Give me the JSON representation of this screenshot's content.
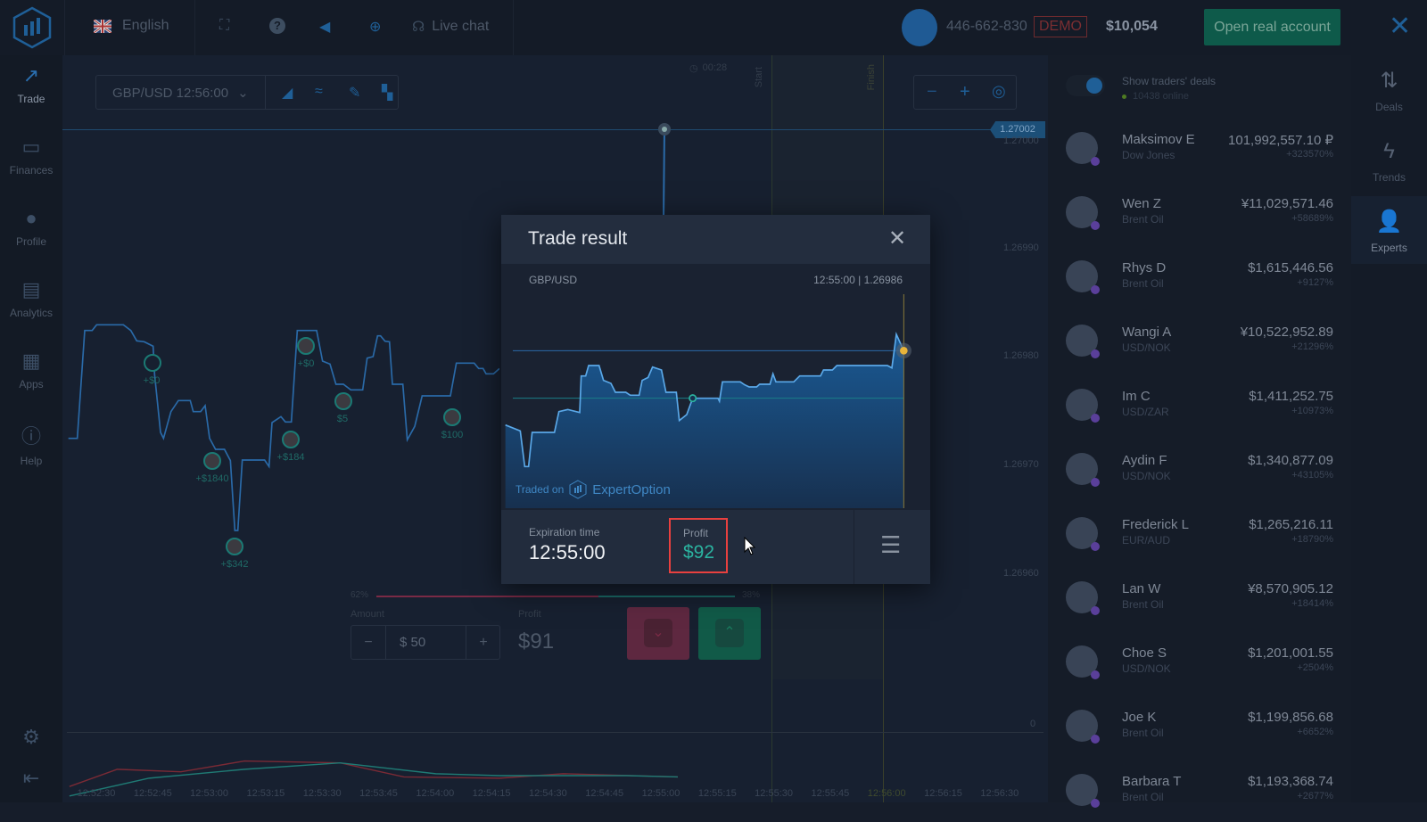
{
  "topbar": {
    "language": "English",
    "live_chat": "Live chat",
    "account_id": "446-662-830",
    "account_mode": "DEMO",
    "balance": "$10,054",
    "open_real_account": "Open real account",
    "icons": [
      "logo-icon",
      "uk-flag-icon",
      "fullscreen-icon",
      "help-icon",
      "sound-icon",
      "target-icon",
      "headset-icon",
      "close-icon"
    ]
  },
  "sidebar": {
    "items": [
      {
        "label": "Trade",
        "icon": "trending-up-icon",
        "active": true
      },
      {
        "label": "Finances",
        "icon": "wallet-icon"
      },
      {
        "label": "Profile",
        "icon": "user-icon"
      },
      {
        "label": "Analytics",
        "icon": "news-icon"
      },
      {
        "label": "Apps",
        "icon": "grid-icon"
      },
      {
        "label": "Help",
        "icon": "info-icon"
      }
    ],
    "bottom_icons": [
      "settings-icon",
      "logout-icon"
    ]
  },
  "chart": {
    "asset_selector": "GBP/USD 12:56:00",
    "timer": "00:28",
    "start_label": "Start",
    "finish_label": "Finish",
    "current_price": "1.27002",
    "price_ticks": [
      "1.27000",
      "1.26990",
      "1.26980",
      "1.26970",
      "1.26960"
    ],
    "oscillator_zero": "0",
    "time_ticks": [
      "12:52:30",
      "12:52:45",
      "12:53:00",
      "12:53:15",
      "12:53:30",
      "12:53:45",
      "12:54:00",
      "12:54:15",
      "12:54:30",
      "12:54:45",
      "12:55:00",
      "12:55:15",
      "12:55:30",
      "12:55:45",
      "12:56:00",
      "12:56:15",
      "12:56:30",
      "12"
    ],
    "trader_markers": [
      "+$0",
      "+$1840",
      "+$342",
      "+$184",
      "+$0",
      "$5",
      "$100"
    ]
  },
  "trade_panel": {
    "sentiment_down": "62%",
    "sentiment_up": "38%",
    "sentiment_down_value": 62,
    "amount_label": "Amount",
    "amount_value": "$ 50",
    "profit_label": "Profit",
    "profit_value": "$91",
    "colors": {
      "down": "#7a2a45",
      "up": "#1a7a5e"
    }
  },
  "modal": {
    "title": "Trade result",
    "asset": "GBP/USD",
    "time_price": "12:55:00 | 1.26986",
    "traded_on": "Traded on",
    "brand": "ExpertOption",
    "expiration_label": "Expiration time",
    "expiration_value": "12:55:00",
    "profit_label": "Profit",
    "profit_value": "$92",
    "profit_color": "#2bb3a0",
    "highlight_color": "#e8403f"
  },
  "experts": {
    "show_deals": "Show traders' deals",
    "online": "10438 online",
    "traders": [
      {
        "name": "Maksimov E",
        "asset": "Dow Jones",
        "amount": "101,992,557.10 ₽",
        "pct": "+323570%"
      },
      {
        "name": "Wen Z",
        "asset": "Brent Oil",
        "amount": "¥11,029,571.46",
        "pct": "+58689%"
      },
      {
        "name": "Rhys D",
        "asset": "Brent Oil",
        "amount": "$1,615,446.56",
        "pct": "+9127%"
      },
      {
        "name": "Wangi A",
        "asset": "USD/NOK",
        "amount": "¥10,522,952.89",
        "pct": "+21296%"
      },
      {
        "name": "Im C",
        "asset": "USD/ZAR",
        "amount": "$1,411,252.75",
        "pct": "+10973%"
      },
      {
        "name": "Aydin F",
        "asset": "USD/NOK",
        "amount": "$1,340,877.09",
        "pct": "+43105%"
      },
      {
        "name": "Frederick L",
        "asset": "EUR/AUD",
        "amount": "$1,265,216.11",
        "pct": "+18790%"
      },
      {
        "name": "Lan W",
        "asset": "Brent Oil",
        "amount": "¥8,570,905.12",
        "pct": "+18414%"
      },
      {
        "name": "Choe S",
        "asset": "USD/NOK",
        "amount": "$1,201,001.55",
        "pct": "+2504%"
      },
      {
        "name": "Joe K",
        "asset": "Brent Oil",
        "amount": "$1,199,856.68",
        "pct": "+6652%"
      },
      {
        "name": "Barbara T",
        "asset": "Brent Oil",
        "amount": "$1,193,368.74",
        "pct": "+2677%"
      }
    ]
  },
  "rail": {
    "items": [
      {
        "label": "Deals",
        "icon": "swap-vertical-icon"
      },
      {
        "label": "Trends",
        "icon": "lightning-icon"
      },
      {
        "label": "Experts",
        "icon": "add-user-icon",
        "active": true
      }
    ]
  }
}
